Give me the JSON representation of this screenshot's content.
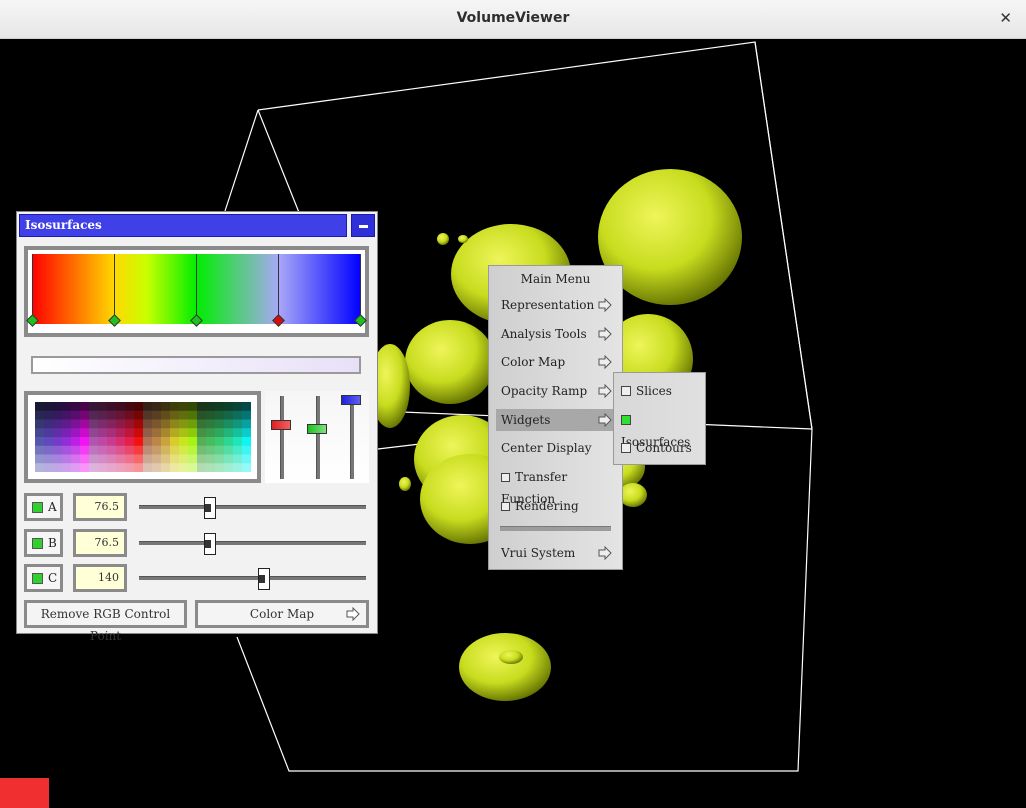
{
  "window": {
    "title": "VolumeViewer",
    "close_glyph": "✕"
  },
  "isosurfaces_dialog": {
    "title": "Isosurfaces",
    "minimize_icon": "minimize-icon",
    "gradient_stops": [
      {
        "color": "#ff0000",
        "selected": false
      },
      {
        "color": "#ffd800",
        "selected": false
      },
      {
        "color": "#00ee00",
        "selected": false
      },
      {
        "color": "#a8a8f8",
        "selected": true
      },
      {
        "color": "#0000ff",
        "selected": false
      }
    ],
    "rgb_sliders": [
      {
        "channel": "R",
        "color": "#e02020"
      },
      {
        "channel": "G",
        "color": "#20c020"
      },
      {
        "channel": "B",
        "color": "#2020e0"
      }
    ],
    "isovalues": [
      {
        "label": "A",
        "value": "76.5",
        "checked": true
      },
      {
        "label": "B",
        "value": "76.5",
        "checked": true
      },
      {
        "label": "C",
        "value": "140",
        "checked": true
      }
    ],
    "remove_button": "Remove RGB Control Point",
    "colormap_button": "Color Map"
  },
  "main_menu": {
    "title": "Main Menu",
    "items": [
      {
        "label": "Representation",
        "submenu": true
      },
      {
        "label": "Analysis Tools",
        "submenu": true
      },
      {
        "label": "Color Map",
        "submenu": true
      },
      {
        "label": "Opacity Ramp",
        "submenu": true
      },
      {
        "label": "Widgets",
        "submenu": true,
        "highlighted": true
      },
      {
        "label": "Center Display",
        "submenu": false
      },
      {
        "label": "Transfer Function",
        "toggle": true
      },
      {
        "label": "Rendering",
        "toggle": true
      }
    ],
    "system_item": {
      "label": "Vrui System",
      "submenu": true
    }
  },
  "widgets_submenu": {
    "items": [
      {
        "label": "Slices",
        "checked": false
      },
      {
        "label": "Isosurfaces",
        "checked": true
      },
      {
        "label": "Contours",
        "checked": false
      }
    ]
  },
  "colors": {
    "isosurface": "#c8dc1e",
    "dialog_title": "#4040e8",
    "status_block": "#f03030"
  }
}
